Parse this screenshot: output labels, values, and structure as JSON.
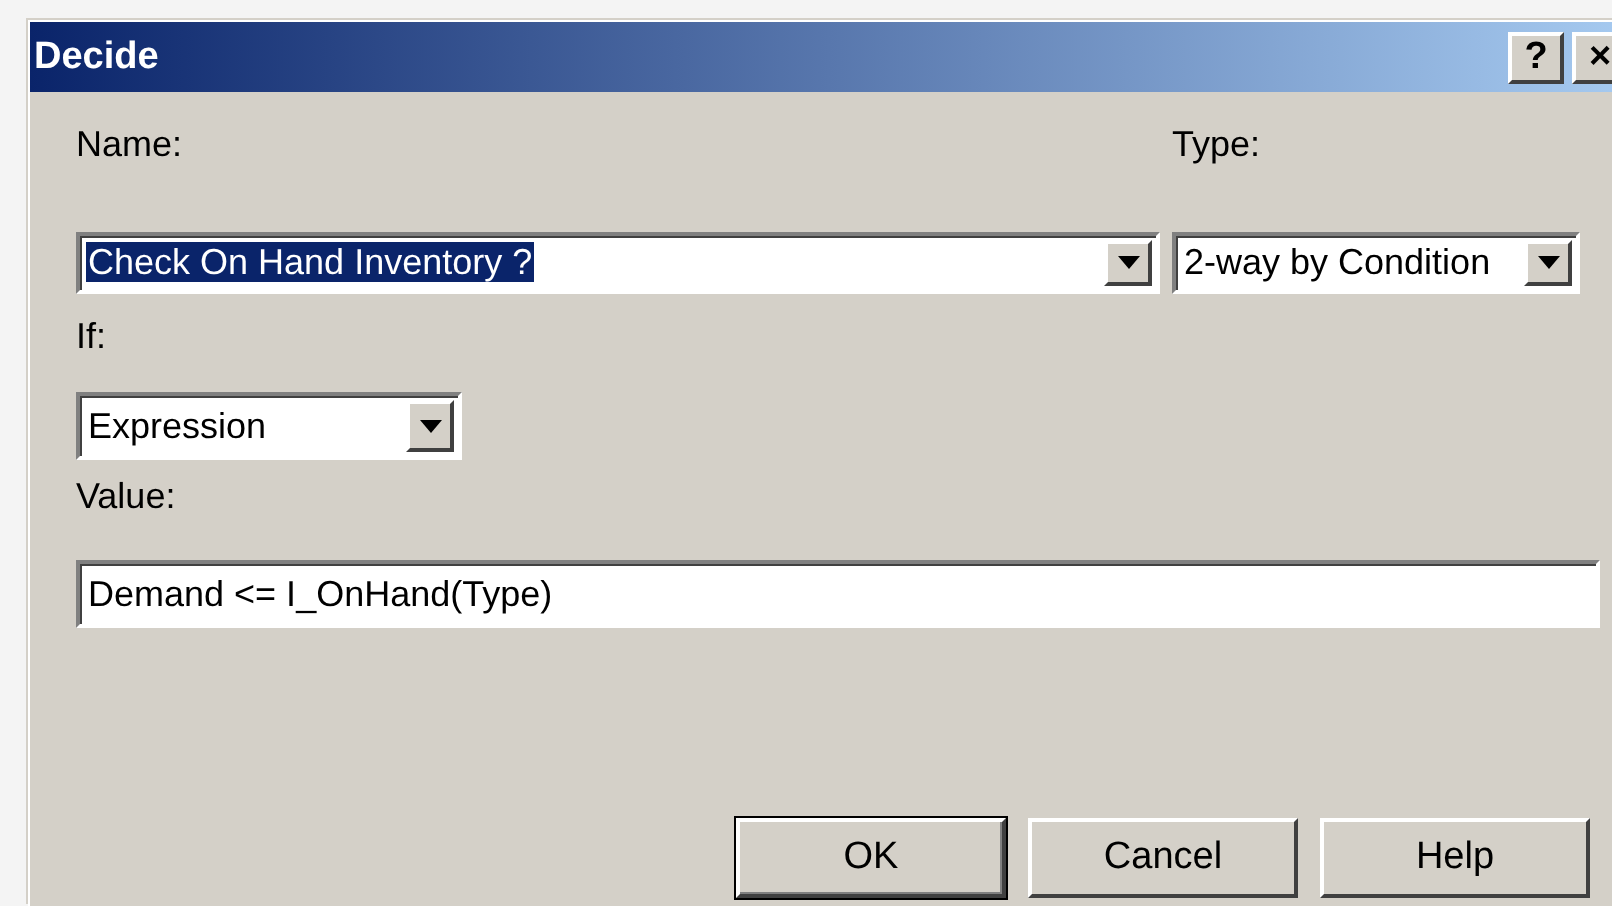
{
  "window": {
    "title": "Decide",
    "title_buttons": [
      {
        "label": "?"
      },
      {
        "label": "×"
      }
    ]
  },
  "name": {
    "label": "Name:",
    "value": "Check On Hand Inventory ?",
    "highlighted": true
  },
  "type": {
    "label": "Type:",
    "value": "2-way by Condition"
  },
  "if": {
    "label": "If:",
    "value": "Expression"
  },
  "value": {
    "label": "Value:",
    "value": "Demand <= I_OnHand(Type)"
  },
  "buttons": [
    {
      "label": "OK",
      "default": true
    },
    {
      "label": "Cancel",
      "default": false
    },
    {
      "label": "Help",
      "default": false
    }
  ]
}
